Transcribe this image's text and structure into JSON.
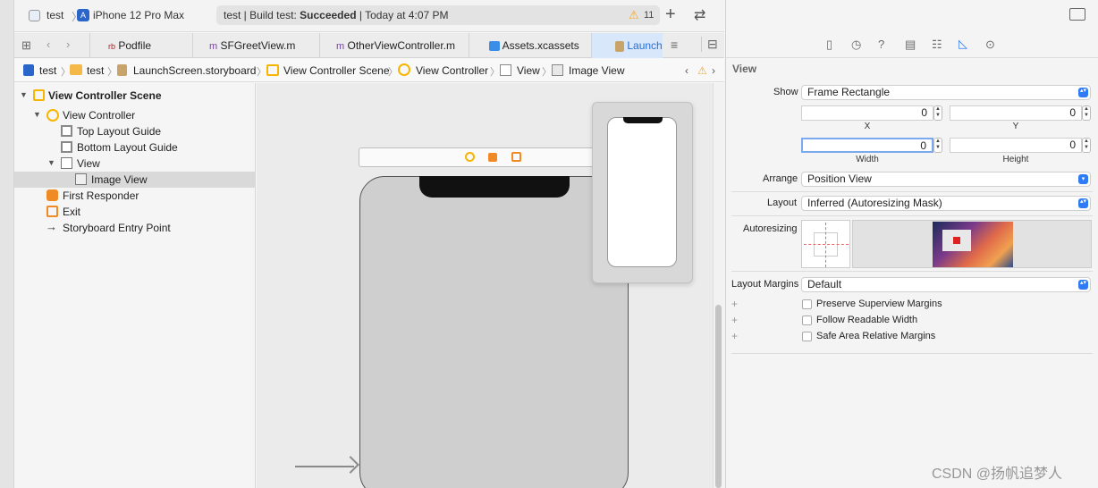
{
  "toolbar": {
    "scheme": "test",
    "device": "iPhone 12 Pro Max",
    "status_prefix": "test | Build test: ",
    "status_result": "Succeeded",
    "status_time": "Today at 4:07 PM",
    "warning_count": "11"
  },
  "tabs": [
    {
      "label": "Podfile",
      "icon": "rb"
    },
    {
      "label": "SFGreetView.m",
      "icon": "m"
    },
    {
      "label": "OtherViewController.m",
      "icon": "m"
    },
    {
      "label": "Assets.xcassets",
      "icon": "asset-catalog-icon"
    },
    {
      "label": "Launch",
      "icon": "storyboard-icon"
    }
  ],
  "jumpbar": [
    "test",
    "test",
    "LaunchScreen.storyboard",
    "View Controller Scene",
    "View Controller",
    "View",
    "Image View"
  ],
  "outline": [
    {
      "label": "View Controller Scene",
      "bold": true,
      "icon": "scene-icon"
    },
    {
      "label": "View Controller",
      "icon": "view-controller-icon"
    },
    {
      "label": "Top Layout Guide",
      "icon": "layout-guide-icon"
    },
    {
      "label": "Bottom Layout Guide",
      "icon": "layout-guide-icon"
    },
    {
      "label": "View",
      "icon": "view-icon"
    },
    {
      "label": "Image View",
      "icon": "image-view-icon"
    },
    {
      "label": "First Responder",
      "icon": "first-responder-icon"
    },
    {
      "label": "Exit",
      "icon": "exit-icon"
    },
    {
      "label": "Storyboard Entry Point",
      "icon": "arrow-right-icon"
    }
  ],
  "inspector": {
    "section_title": "View",
    "show_label": "Show",
    "show_value": "Frame Rectangle",
    "x_value": "0",
    "y_value": "0",
    "x_caption": "X",
    "y_caption": "Y",
    "width_value": "0",
    "height_value": "0",
    "width_caption": "Width",
    "height_caption": "Height",
    "arrange_label": "Arrange",
    "arrange_value": "Position View",
    "layout_label": "Layout",
    "layout_value": "Inferred (Autoresizing Mask)",
    "autoresizing_label": "Autoresizing",
    "margins_label": "Layout Margins",
    "margins_value": "Default",
    "checkboxes": [
      {
        "label": "Preserve Superview Margins",
        "checked": false
      },
      {
        "label": "Follow Readable Width",
        "checked": false
      },
      {
        "label": "Safe Area Relative Margins",
        "checked": false
      }
    ]
  },
  "watermark": "CSDN @扬帆追梦人",
  "colors": {
    "accent": "#2f7bf6",
    "warning": "#f5a623",
    "scene_yellow": "#f7b500",
    "exit_orange": "#f08a24"
  }
}
